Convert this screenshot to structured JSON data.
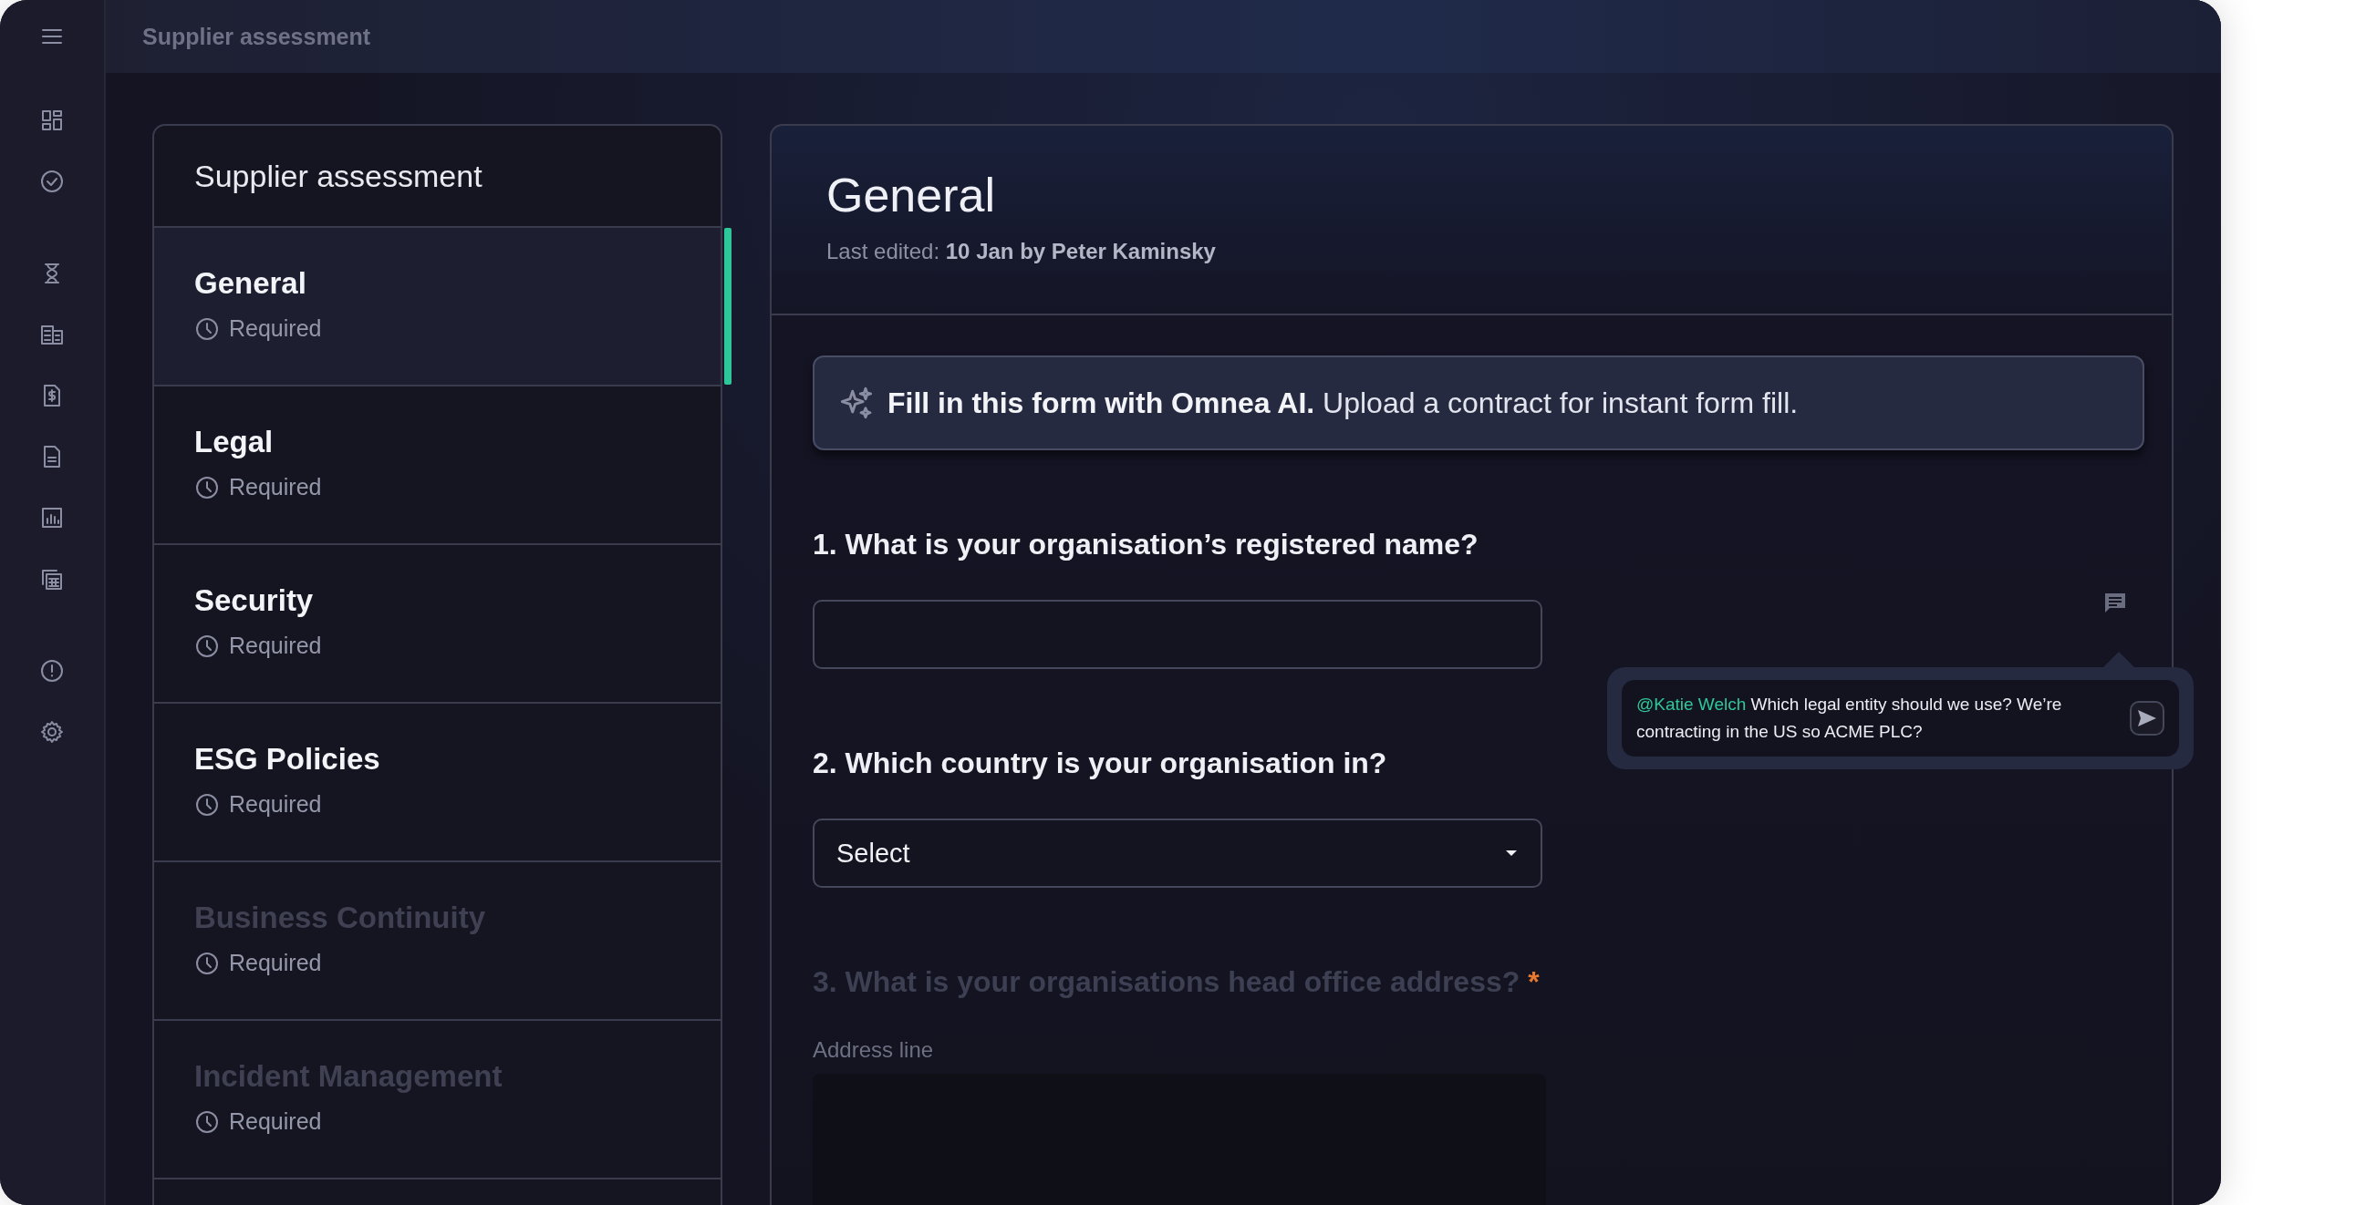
{
  "header": {
    "title": "Supplier assessment"
  },
  "sections": {
    "title": "Supplier assessment",
    "items": [
      {
        "title": "General",
        "status": "Required",
        "selected": true,
        "disabled": false
      },
      {
        "title": "Legal",
        "status": "Required",
        "selected": false,
        "disabled": false
      },
      {
        "title": "Security",
        "status": "Required",
        "selected": false,
        "disabled": false
      },
      {
        "title": "ESG Policies",
        "status": "Required",
        "selected": false,
        "disabled": false
      },
      {
        "title": "Business Continuity",
        "status": "Required",
        "selected": false,
        "disabled": true
      },
      {
        "title": "Incident Management",
        "status": "Required",
        "selected": false,
        "disabled": true
      }
    ]
  },
  "form": {
    "title": "General",
    "edited": "Last edited: **10 Jan by Peter Kaminsky**",
    "ai_banner": "**Fill in this form with Omnea AI.** Upload a contract for instant form fill.",
    "questions": [
      {
        "kind": "text",
        "label": "1. What is your organisation’s registered name?",
        "disabled": false
      },
      {
        "kind": "select",
        "label": "2. Which country is your organisation in?",
        "placeholder": "Select",
        "disabled": false
      },
      {
        "kind": "address",
        "label": "3. What is your organisations head office address?",
        "asterisk": "*",
        "field_label": "Address line",
        "disabled": true
      }
    ]
  },
  "comment": {
    "mention": "@Katie Welch",
    "text": "Which legal entity should we use? We’re contracting in the US so ACME PLC?"
  }
}
